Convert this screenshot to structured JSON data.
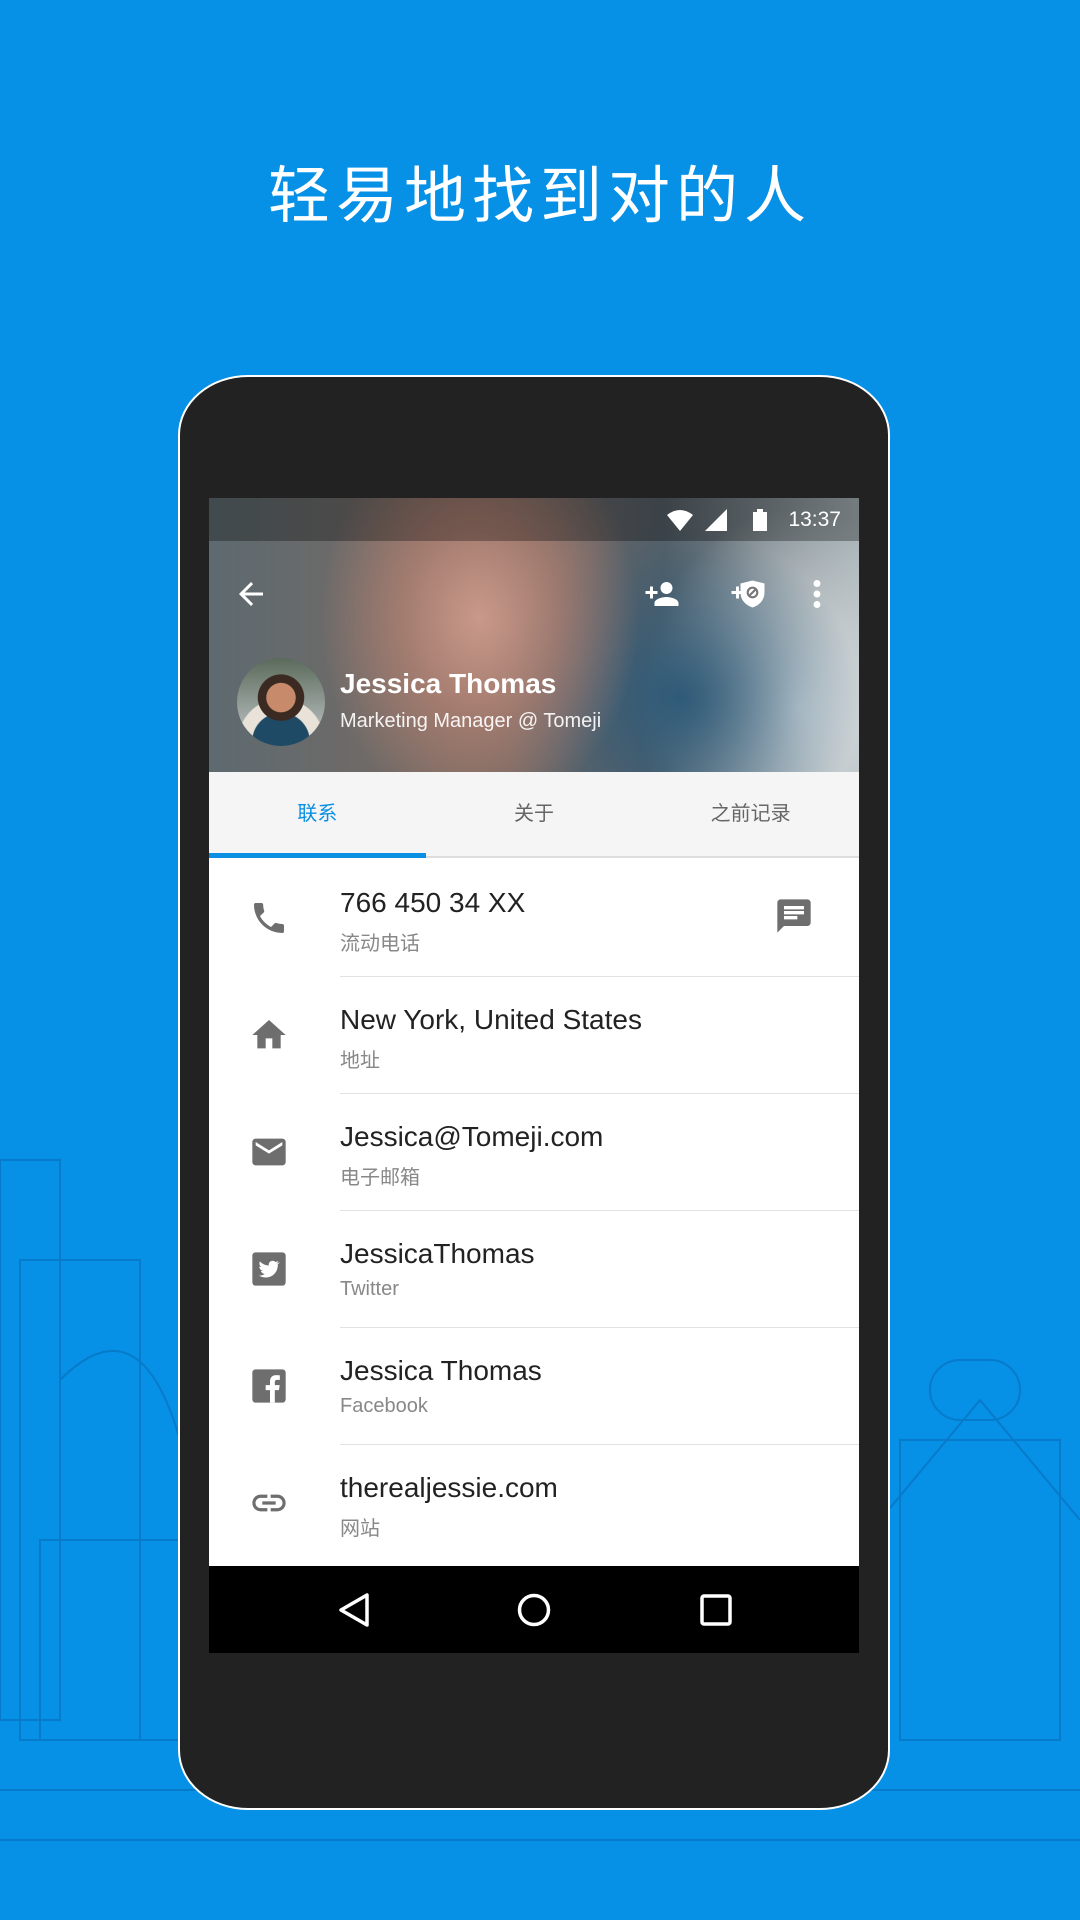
{
  "headline": "轻易地找到对的人",
  "colors": {
    "background": "#0690e6",
    "accent": "#0a8fe3",
    "icon": "#6e6e6e"
  },
  "status_bar": {
    "time": "13:37",
    "icons": [
      "wifi-icon",
      "signal-icon",
      "battery-icon"
    ]
  },
  "toolbar": {
    "icons": [
      "back-arrow-icon",
      "add-contact-icon",
      "block-icon",
      "more-vert-icon"
    ]
  },
  "profile": {
    "name": "Jessica Thomas",
    "role": "Marketing Manager @ Tomeji"
  },
  "tabs": [
    {
      "label": "联系",
      "active": true
    },
    {
      "label": "关于",
      "active": false
    },
    {
      "label": "之前记录",
      "active": false
    }
  ],
  "rows": [
    {
      "icon": "phone-icon",
      "value": "766 450 34 XX",
      "label": "流动电话",
      "action_icon": "message-icon"
    },
    {
      "icon": "home-icon",
      "value": "New York, United States",
      "label": "地址"
    },
    {
      "icon": "email-icon",
      "value": "Jessica@Tomeji.com",
      "label": "电子邮箱"
    },
    {
      "icon": "twitter-icon",
      "value": "JessicaThomas",
      "label": "Twitter"
    },
    {
      "icon": "facebook-icon",
      "value": "Jessica Thomas",
      "label": "Facebook"
    },
    {
      "icon": "link-icon",
      "value": "therealjessie.com",
      "label": "网站"
    }
  ],
  "nav_bar": {
    "icons": [
      "back-triangle-icon",
      "home-circle-icon",
      "recents-square-icon"
    ]
  }
}
